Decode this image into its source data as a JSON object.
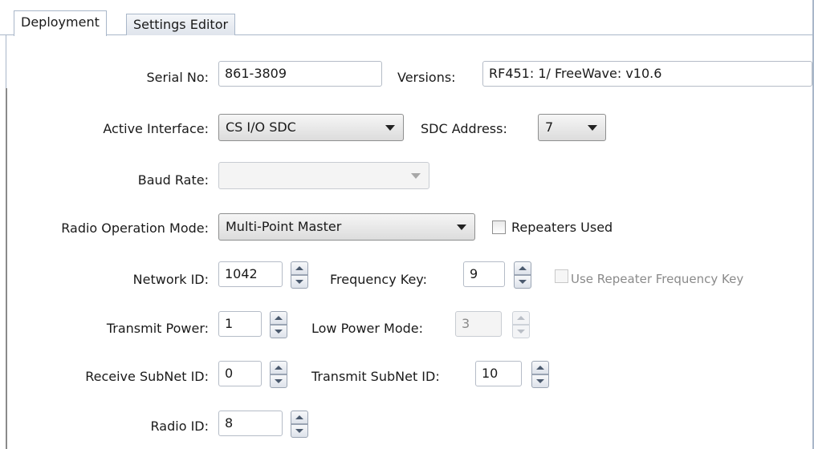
{
  "tabs": [
    {
      "label": "Deployment",
      "active": true
    },
    {
      "label": "Settings Editor",
      "active": false
    }
  ],
  "form": {
    "serial_no": {
      "label": "Serial No:",
      "value": "861-3809"
    },
    "versions": {
      "label": "Versions:",
      "value": "RF451: 1/ FreeWave: v10.6"
    },
    "active_interface": {
      "label": "Active Interface:",
      "value": "CS I/O SDC"
    },
    "sdc_address": {
      "label": "SDC Address:",
      "value": "7"
    },
    "baud_rate": {
      "label": "Baud Rate:",
      "value": ""
    },
    "radio_operation_mode": {
      "label": "Radio Operation Mode:",
      "value": "Multi-Point Master"
    },
    "repeaters_used": {
      "label": "Repeaters Used",
      "checked": false
    },
    "network_id": {
      "label": "Network ID:",
      "value": "1042"
    },
    "frequency_key": {
      "label": "Frequency Key:",
      "value": "9"
    },
    "use_repeater_frequency_key": {
      "label": "Use Repeater Frequency Key",
      "checked": false
    },
    "transmit_power": {
      "label": "Transmit Power:",
      "value": "1"
    },
    "low_power_mode": {
      "label": "Low Power Mode:",
      "value": "3"
    },
    "receive_subnet_id": {
      "label": "Receive SubNet ID:",
      "value": "0"
    },
    "transmit_subnet_id": {
      "label": "Transmit SubNet ID:",
      "value": "10"
    },
    "radio_id": {
      "label": "Radio ID:",
      "value": "8"
    }
  }
}
